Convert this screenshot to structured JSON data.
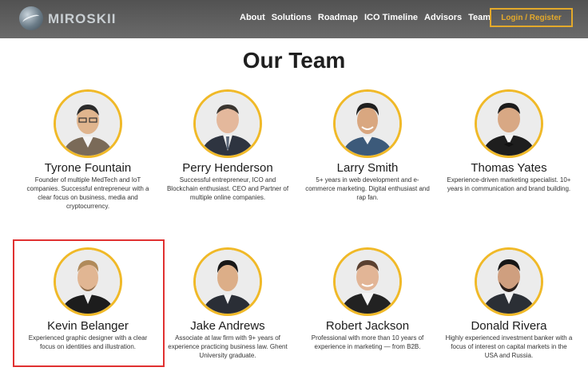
{
  "header": {
    "logo_text": "MIROSKII",
    "nav": [
      "About",
      "Solutions",
      "Roadmap",
      "ICO Timeline",
      "Advisors",
      "Team"
    ],
    "login_label": "Login / Register",
    "colors": {
      "accent": "#e3a92b",
      "bar": "#5b5b5b"
    }
  },
  "page_title": "Our Team",
  "members": [
    {
      "name": "Tyrone Fountain",
      "bio": "Founder of multiple MedTech and IoT companies. Successful entrepreneur with a clear focus on business, media and cryptocurrency."
    },
    {
      "name": "Perry Henderson",
      "bio": "Successful entrepreneur, ICO and Blockchain enthusiast. CEO and Partner of multiple online companies."
    },
    {
      "name": "Larry Smith",
      "bio": "5+ years in web development and e-commerce marketing. Digital enthusiast and rap fan."
    },
    {
      "name": "Thomas Yates",
      "bio": "Experience-driven marketing specialist. 10+ years in communication and brand building."
    },
    {
      "name": "Kevin Belanger",
      "bio": "Experienced graphic designer with a clear focus on identities and illustration."
    },
    {
      "name": "Jake Andrews",
      "bio": "Associate at law firm with 9+ years of experience practicing business law. Ghent University graduate."
    },
    {
      "name": "Robert Jackson",
      "bio": "Professional with more than 10 years of experience in marketing — from B2B."
    },
    {
      "name": "Donald Rivera",
      "bio": "Highly experienced investment banker with a focus of interest on capital markets in the USA and Russia."
    }
  ]
}
